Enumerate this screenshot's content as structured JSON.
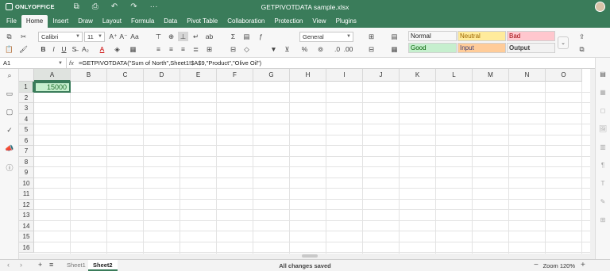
{
  "app": {
    "logo_text": "ONLYOFFICE",
    "document_title": "GETPIVOTDATA sample.xlsx"
  },
  "menu": {
    "items": [
      "File",
      "Home",
      "Insert",
      "Draw",
      "Layout",
      "Formula",
      "Data",
      "Pivot Table",
      "Collaboration",
      "Protection",
      "View",
      "Plugins"
    ],
    "active": "Home"
  },
  "toolbar": {
    "font_name": "Calibri",
    "font_size": "11",
    "number_format": "General",
    "styles": [
      {
        "label": "Normal",
        "bg": "#ffffff",
        "color": "#000000"
      },
      {
        "label": "Neutral",
        "bg": "#ffeb9c",
        "color": "#9c6500"
      },
      {
        "label": "Bad",
        "bg": "#ffc7ce",
        "color": "#9c0006"
      },
      {
        "label": "Good",
        "bg": "#c6efce",
        "color": "#006100"
      },
      {
        "label": "Input",
        "bg": "#ffcc99",
        "color": "#3f3f76"
      },
      {
        "label": "Output",
        "bg": "#f2f2f2",
        "color": "#3f3f3f"
      }
    ]
  },
  "formula_bar": {
    "cell_ref": "A1",
    "fx": "fx",
    "formula": "=GETPIVOTDATA(\"Sum of North\",Sheet1!$A$9,\"Product\",\"Olive Oil\")"
  },
  "grid": {
    "columns": [
      "A",
      "B",
      "C",
      "D",
      "E",
      "F",
      "G",
      "H",
      "I",
      "J",
      "K",
      "L",
      "M",
      "N",
      "O"
    ],
    "rows": [
      "1",
      "2",
      "3",
      "4",
      "5",
      "6",
      "7",
      "8",
      "9",
      "10",
      "11",
      "12",
      "13",
      "14",
      "15",
      "16"
    ],
    "active_cell": "A1",
    "a1_value": "15000"
  },
  "status": {
    "sheets": [
      "Sheet1",
      "Sheet2"
    ],
    "active_sheet": "Sheet2",
    "save_status": "All changes saved",
    "zoom": "Zoom 120%",
    "zoom_minus": "−",
    "zoom_plus": "+"
  },
  "colors": {
    "accent": "#3a7c5a",
    "good_fill": "#c6efce"
  }
}
